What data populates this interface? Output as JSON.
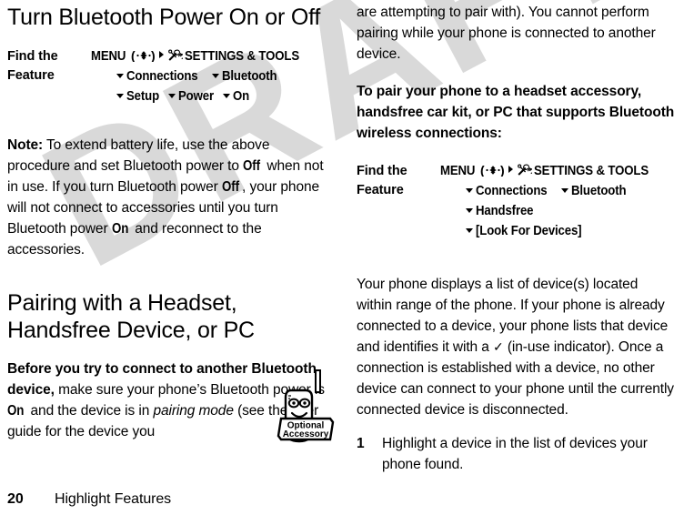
{
  "document": {
    "watermark": "DRAFT",
    "watermark_color": "#d9d9d9",
    "footer": {
      "page_number": "20",
      "running_title": "Highlight Features"
    }
  },
  "left_column": {
    "heading": "Turn Bluetooth Power On or Off",
    "find_the_feature": {
      "label": "Find the Feature",
      "menu_word": "MENU",
      "nav_key_icon": "navigation-key-icon",
      "tools_icon": "settings-tools-icon",
      "root": "SETTINGS & TOOLS",
      "rows": [
        [
          "Connections",
          "Bluetooth"
        ],
        [
          "Setup",
          "Power",
          "On"
        ]
      ]
    },
    "note": {
      "label": "Note:",
      "text_1": " To extend battery life, use the above procedure and set Bluetooth power to ",
      "token_1": "Off",
      "text_2": " when not in use. If you turn Bluetooth power ",
      "token_2": "Off",
      "text_3": ", your phone will not connect to accessories until you turn Bluetooth power ",
      "token_3": "On",
      "text_4": " and reconnect to the accessories."
    },
    "heading_2": "Pairing with a Headset, Handsfree Device, or PC",
    "pairing_intro": {
      "lead": "Before you try to connect to another Bluetooth device,",
      "text_1": " make sure your phone’s Bluetooth power is ",
      "token_1": "On",
      "text_2": " and the device is in ",
      "italic_1": "pairing mode",
      "text_3": " (see the user guide for the device you"
    },
    "accessory_badge": {
      "icon": "optional-accessory-icon",
      "line_1": "Optional",
      "line_2": "Accessory"
    }
  },
  "right_column": {
    "continued_paragraph": "are attempting to pair with). You cannot perform pairing while your phone is connected to another device.",
    "lead_paragraph": "To pair your phone to a headset accessory, handsfree car kit, or PC that supports Bluetooth wireless connections:",
    "find_the_feature": {
      "label": "Find the Feature",
      "menu_word": "MENU",
      "nav_key_icon": "navigation-key-icon",
      "tools_icon": "settings-tools-icon",
      "root": "SETTINGS & TOOLS",
      "rows": [
        [
          "Connections",
          "Bluetooth"
        ],
        [
          "Handsfree"
        ],
        [
          "[Look For Devices]"
        ]
      ]
    },
    "description": {
      "text_1": "Your phone displays a list of device(s) located within range of the phone. If your phone is already connected to a device, your phone lists that device and identifies it with a ",
      "check_icon": "✓",
      "text_2": " (in-use indicator). Once a connection is established with a device, no other device can connect to your phone until the currently connected device is disconnected."
    },
    "steps": [
      {
        "number": "1",
        "text": "Highlight a device in the list of devices your phone found."
      }
    ]
  }
}
